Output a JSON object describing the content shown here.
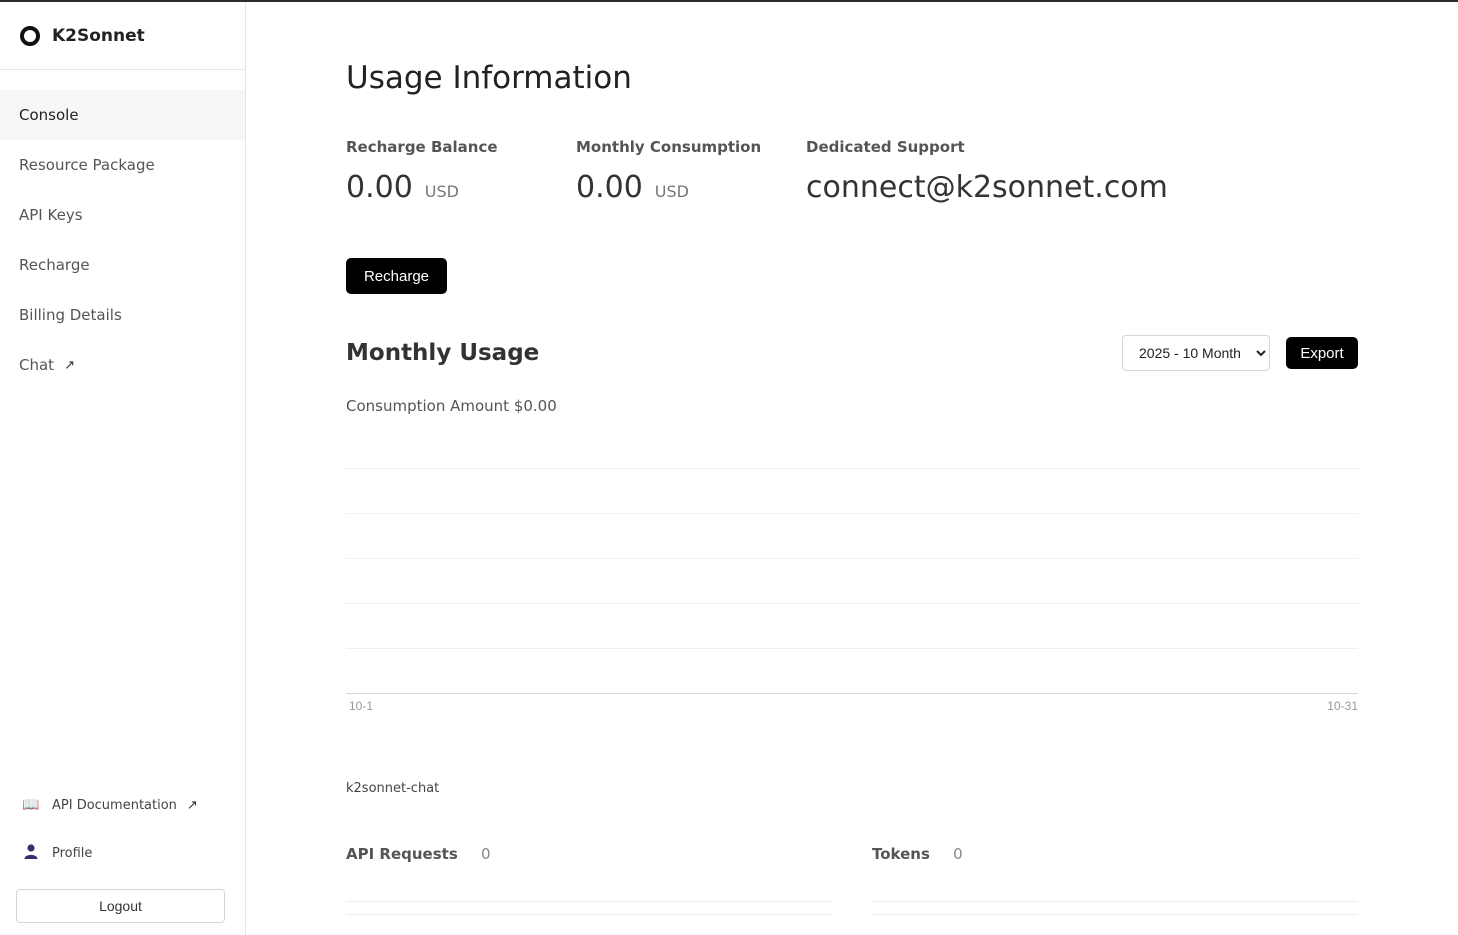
{
  "brand": {
    "name": "K2Sonnet",
    "logo_icon": "ring-logo-icon"
  },
  "sidebar": {
    "items": [
      {
        "label": "Console",
        "active": true
      },
      {
        "label": "Resource Package"
      },
      {
        "label": "API Keys"
      },
      {
        "label": "Recharge"
      },
      {
        "label": "Billing Details"
      },
      {
        "label": "Chat",
        "external": "↗"
      }
    ],
    "bottom": {
      "api_docs": {
        "label": "API Documentation",
        "external": "↗",
        "icon": "book-icon"
      },
      "profile": {
        "label": "Profile",
        "icon": "user-icon"
      },
      "logout": "Logout"
    }
  },
  "main": {
    "title": "Usage Information",
    "stats": {
      "balance": {
        "label": "Recharge Balance",
        "value": "0.00",
        "unit": "USD"
      },
      "monthly": {
        "label": "Monthly Consumption",
        "value": "0.00",
        "unit": "USD"
      },
      "support": {
        "label": "Dedicated Support",
        "value": "connect@k2sonnet.com"
      }
    },
    "recharge_button": "Recharge",
    "usage": {
      "title": "Monthly Usage",
      "month_selected": "2025 - 10 Month",
      "export_button": "Export",
      "consumption_label": "Consumption Amount $0.00"
    },
    "model": {
      "name": "k2sonnet-chat",
      "api_requests": {
        "label": "API Requests",
        "value": "0"
      },
      "tokens": {
        "label": "Tokens",
        "value": "0"
      }
    }
  },
  "chart_data": {
    "type": "bar",
    "x_start": "10-1",
    "x_end": "10-31",
    "values": [],
    "grid": true
  }
}
